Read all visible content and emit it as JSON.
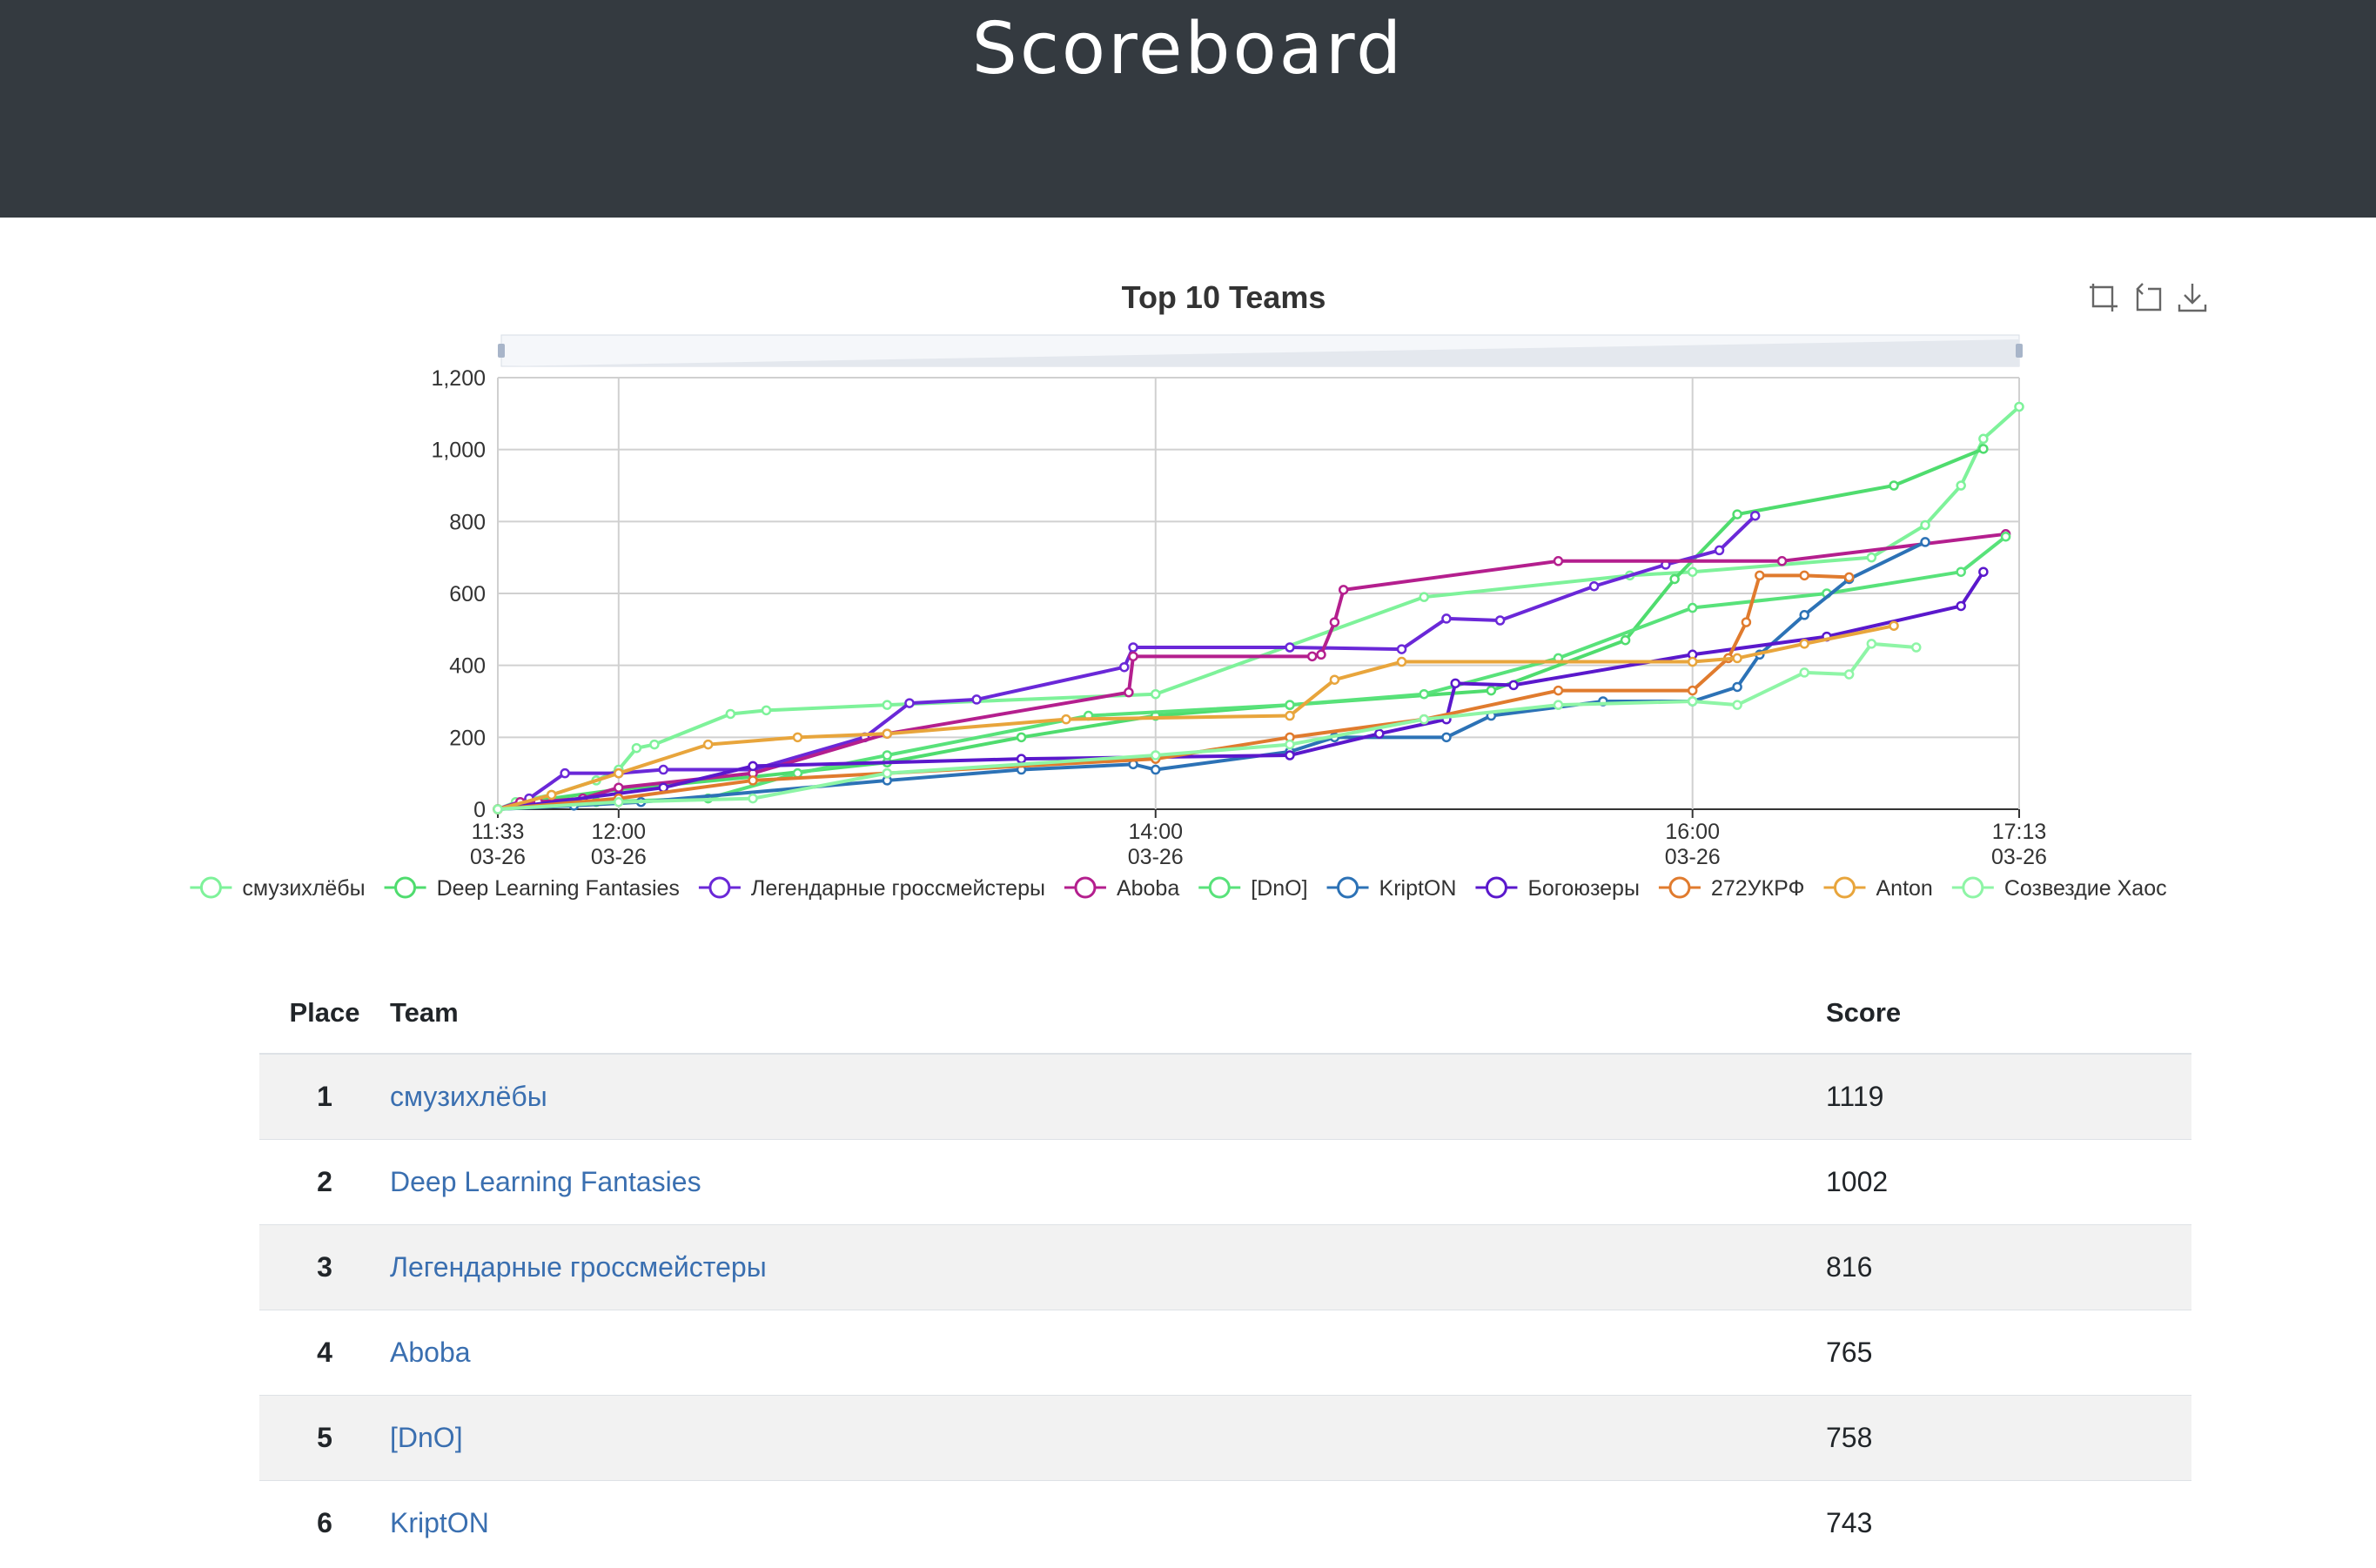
{
  "header": {
    "title": "Scoreboard"
  },
  "chart_data": {
    "type": "line",
    "title": "Top 10 Teams",
    "xlabel": "",
    "ylabel": "",
    "ylim": [
      0,
      1200
    ],
    "y_ticks": [
      0,
      200,
      400,
      600,
      800,
      1000,
      1200
    ],
    "y_tick_labels": [
      "0",
      "200",
      "400",
      "600",
      "800",
      "1,000",
      "1,200"
    ],
    "xlim": [
      "11:33",
      "17:13"
    ],
    "x_ticks": [
      {
        "time": "11:33",
        "date": "03-26"
      },
      {
        "time": "12:00",
        "date": "03-26"
      },
      {
        "time": "14:00",
        "date": "03-26"
      },
      {
        "time": "16:00",
        "date": "03-26"
      },
      {
        "time": "17:13",
        "date": "03-26"
      }
    ],
    "grid": true,
    "legend_position": "bottom",
    "series": [
      {
        "name": "смузихлёбы",
        "color": "#7ef29a",
        "points": [
          [
            "11:33",
            0
          ],
          [
            "11:37",
            20
          ],
          [
            "11:45",
            40
          ],
          [
            "11:55",
            80
          ],
          [
            "12:00",
            110
          ],
          [
            "12:04",
            170
          ],
          [
            "12:08",
            180
          ],
          [
            "12:25",
            265
          ],
          [
            "12:33",
            275
          ],
          [
            "13:00",
            290
          ],
          [
            "14:00",
            320
          ],
          [
            "15:00",
            590
          ],
          [
            "15:46",
            650
          ],
          [
            "16:00",
            660
          ],
          [
            "16:40",
            700
          ],
          [
            "16:52",
            790
          ],
          [
            "17:00",
            900
          ],
          [
            "17:05",
            1030
          ],
          [
            "17:13",
            1119
          ]
        ]
      },
      {
        "name": "Deep Learning Fantasies",
        "color": "#4fdc6e",
        "points": [
          [
            "11:33",
            0
          ],
          [
            "11:45",
            30
          ],
          [
            "12:00",
            55
          ],
          [
            "12:30",
            90
          ],
          [
            "13:00",
            130
          ],
          [
            "13:30",
            200
          ],
          [
            "14:00",
            260
          ],
          [
            "14:30",
            290
          ],
          [
            "15:15",
            330
          ],
          [
            "15:45",
            470
          ],
          [
            "15:56",
            640
          ],
          [
            "16:10",
            820
          ],
          [
            "16:45",
            900
          ],
          [
            "17:05",
            1002
          ]
        ]
      },
      {
        "name": "Легендарные гроссмейстеры",
        "color": "#6a28d8",
        "points": [
          [
            "11:33",
            0
          ],
          [
            "11:40",
            30
          ],
          [
            "11:48",
            100
          ],
          [
            "12:00",
            100
          ],
          [
            "12:10",
            110
          ],
          [
            "12:30",
            110
          ],
          [
            "12:55",
            200
          ],
          [
            "13:05",
            295
          ],
          [
            "13:20",
            305
          ],
          [
            "13:53",
            395
          ],
          [
            "13:55",
            450
          ],
          [
            "14:30",
            450
          ],
          [
            "14:55",
            445
          ],
          [
            "15:05",
            530
          ],
          [
            "15:17",
            525
          ],
          [
            "15:38",
            620
          ],
          [
            "15:54",
            680
          ],
          [
            "16:06",
            720
          ],
          [
            "16:14",
            816
          ]
        ]
      },
      {
        "name": "Aboba",
        "color": "#b41f8e",
        "points": [
          [
            "11:33",
            0
          ],
          [
            "11:38",
            20
          ],
          [
            "11:42",
            20
          ],
          [
            "11:52",
            30
          ],
          [
            "12:00",
            60
          ],
          [
            "12:30",
            100
          ],
          [
            "13:00",
            210
          ],
          [
            "13:54",
            325
          ],
          [
            "13:55",
            425
          ],
          [
            "14:35",
            425
          ],
          [
            "14:37",
            430
          ],
          [
            "14:40",
            520
          ],
          [
            "14:42",
            610
          ],
          [
            "15:30",
            690
          ],
          [
            "16:20",
            690
          ],
          [
            "17:10",
            765
          ]
        ]
      },
      {
        "name": "[DnO]",
        "color": "#58e27a",
        "points": [
          [
            "11:33",
            0
          ],
          [
            "11:55",
            20
          ],
          [
            "12:20",
            30
          ],
          [
            "12:40",
            100
          ],
          [
            "13:00",
            150
          ],
          [
            "13:45",
            260
          ],
          [
            "14:30",
            290
          ],
          [
            "15:00",
            320
          ],
          [
            "15:30",
            420
          ],
          [
            "16:00",
            560
          ],
          [
            "16:30",
            600
          ],
          [
            "17:00",
            660
          ],
          [
            "17:10",
            758
          ]
        ]
      },
      {
        "name": "KriptON",
        "color": "#2c72b6",
        "points": [
          [
            "11:33",
            0
          ],
          [
            "11:50",
            10
          ],
          [
            "12:05",
            20
          ],
          [
            "13:00",
            80
          ],
          [
            "13:30",
            110
          ],
          [
            "13:55",
            125
          ],
          [
            "14:00",
            110
          ],
          [
            "14:30",
            160
          ],
          [
            "14:40",
            200
          ],
          [
            "15:05",
            200
          ],
          [
            "15:15",
            260
          ],
          [
            "15:40",
            300
          ],
          [
            "16:00",
            300
          ],
          [
            "16:10",
            340
          ],
          [
            "16:15",
            430
          ],
          [
            "16:25",
            540
          ],
          [
            "16:35",
            640
          ],
          [
            "16:52",
            743
          ]
        ]
      },
      {
        "name": "Богоюзеры",
        "color": "#5a18cc",
        "points": [
          [
            "11:33",
            0
          ],
          [
            "12:10",
            60
          ],
          [
            "12:30",
            120
          ],
          [
            "13:30",
            140
          ],
          [
            "14:30",
            150
          ],
          [
            "14:50",
            210
          ],
          [
            "15:05",
            250
          ],
          [
            "15:07",
            350
          ],
          [
            "15:20",
            345
          ],
          [
            "16:00",
            430
          ],
          [
            "16:30",
            480
          ],
          [
            "17:00",
            565
          ],
          [
            "17:05",
            660
          ]
        ]
      },
      {
        "name": "272УКРФ",
        "color": "#e07b2e",
        "points": [
          [
            "11:33",
            0
          ],
          [
            "12:00",
            30
          ],
          [
            "12:30",
            80
          ],
          [
            "13:00",
            100
          ],
          [
            "14:00",
            140
          ],
          [
            "14:30",
            200
          ],
          [
            "15:00",
            250
          ],
          [
            "15:30",
            330
          ],
          [
            "16:00",
            330
          ],
          [
            "16:08",
            420
          ],
          [
            "16:12",
            520
          ],
          [
            "16:15",
            650
          ],
          [
            "16:25",
            650
          ],
          [
            "16:35",
            645
          ]
        ]
      },
      {
        "name": "Anton",
        "color": "#e8a53c",
        "points": [
          [
            "11:33",
            0
          ],
          [
            "11:45",
            40
          ],
          [
            "12:00",
            100
          ],
          [
            "12:20",
            180
          ],
          [
            "12:40",
            200
          ],
          [
            "13:00",
            210
          ],
          [
            "13:40",
            250
          ],
          [
            "14:30",
            260
          ],
          [
            "14:40",
            360
          ],
          [
            "14:55",
            410
          ],
          [
            "16:00",
            410
          ],
          [
            "16:10",
            420
          ],
          [
            "16:25",
            460
          ],
          [
            "16:45",
            510
          ]
        ]
      },
      {
        "name": "Созвездие Хаос",
        "color": "#8ef5a6",
        "points": [
          [
            "11:33",
            0
          ],
          [
            "12:00",
            20
          ],
          [
            "12:30",
            30
          ],
          [
            "13:00",
            100
          ],
          [
            "14:00",
            150
          ],
          [
            "14:30",
            180
          ],
          [
            "15:00",
            250
          ],
          [
            "15:30",
            290
          ],
          [
            "16:00",
            300
          ],
          [
            "16:10",
            290
          ],
          [
            "16:25",
            380
          ],
          [
            "16:35",
            375
          ],
          [
            "16:40",
            460
          ],
          [
            "16:50",
            450
          ]
        ]
      }
    ]
  },
  "table": {
    "headers": {
      "place": "Place",
      "team": "Team",
      "score": "Score"
    },
    "rows": [
      {
        "place": "1",
        "team": "смузихлёбы",
        "score": "1119"
      },
      {
        "place": "2",
        "team": "Deep Learning Fantasies",
        "score": "1002"
      },
      {
        "place": "3",
        "team": "Легендарные гроссмейстеры",
        "score": "816"
      },
      {
        "place": "4",
        "team": "Aboba",
        "score": "765"
      },
      {
        "place": "5",
        "team": "[DnO]",
        "score": "758"
      },
      {
        "place": "6",
        "team": "KriptON",
        "score": "743"
      }
    ]
  },
  "toolbox": {
    "icons": [
      "zoom-icon",
      "zoom-reset-icon",
      "download-icon"
    ]
  }
}
